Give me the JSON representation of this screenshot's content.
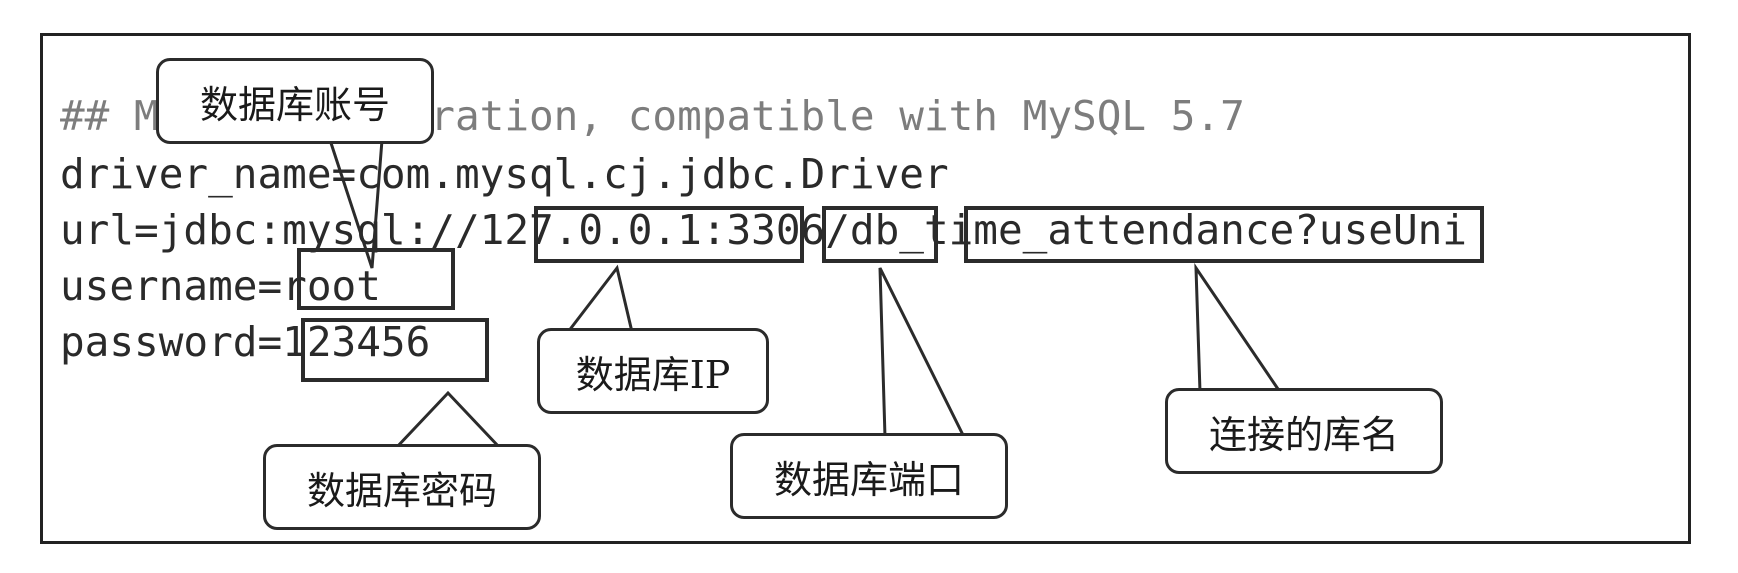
{
  "code_lines": [
    "## MySQL configration, compatible with MySQL 5.7",
    "driver_name=com.mysql.cj.jdbc.Driver",
    "url=jdbc:mysql://127.0.0.1:3306/db_time_attendance?useUni",
    "username=root",
    "password=123456"
  ],
  "callouts": {
    "db_account": "数据库账号",
    "db_ip": "数据库IP",
    "db_password": "数据库密码",
    "db_port": "数据库端口",
    "db_name": "连接的库名"
  }
}
